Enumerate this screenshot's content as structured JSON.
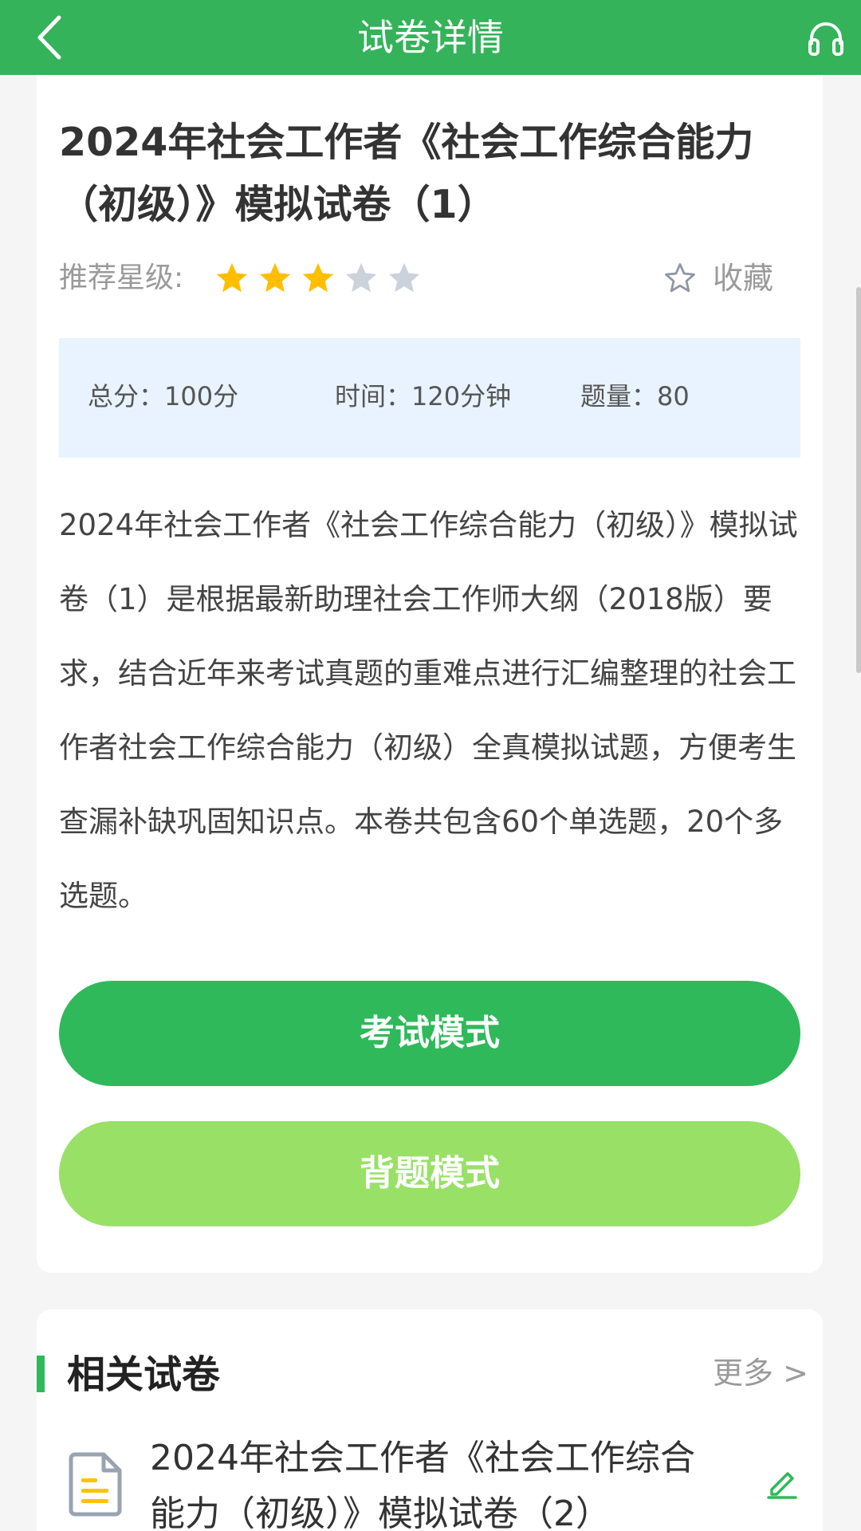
{
  "header": {
    "title": "试卷详情"
  },
  "paper": {
    "title": "2024年社会工作者《社会工作综合能力（初级）》模拟试卷（1）",
    "rating_label": "推荐星级:",
    "rating": 3,
    "rating_max": 5,
    "collect_label": "收藏",
    "info": {
      "total_score": "总分：100分",
      "time": "时间：120分钟",
      "count": "题量：80"
    },
    "description": "2024年社会工作者《社会工作综合能力（初级）》模拟试卷（1）是根据最新助理社会工作师大纲（2018版）要求，结合近年来考试真题的重难点进行汇编整理的社会工作者社会工作综合能力（初级）全真模拟试题，方便考生查漏补缺巩固知识点。本卷共包含60个单选题，20个多选题。"
  },
  "buttons": {
    "exam": "考试模式",
    "study": "背题模式"
  },
  "related": {
    "title": "相关试卷",
    "more": "更多 >",
    "items": [
      {
        "title": "2024年社会工作者《社会工作综合能力（初级）》模拟试卷（2）"
      }
    ]
  },
  "colors": {
    "primary": "#34b35a",
    "button_exam": "#2fb95a",
    "button_study": "#98e066",
    "star_on": "#ffbf00",
    "star_off": "#ccd2dc",
    "info_bg": "#e8f3ff"
  },
  "icons": [
    "back-arrow-icon",
    "headset-icon",
    "star-icon",
    "collect-star-icon",
    "document-icon",
    "edit-pencil-icon"
  ]
}
